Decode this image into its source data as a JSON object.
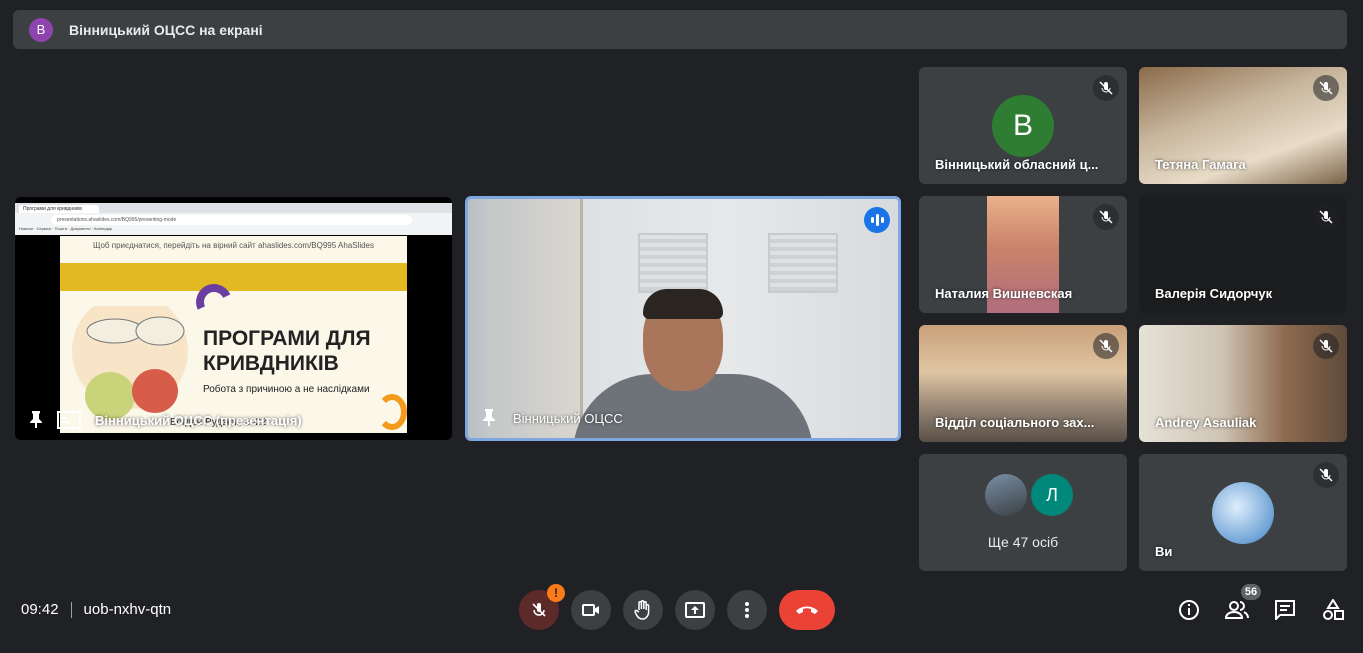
{
  "banner": {
    "avatar_letter": "В",
    "text": "Вінницький ОЦСС на екрані"
  },
  "presentation": {
    "name": "Вінницький ОЦСС (презентація)",
    "browser_tab": "Програми для кривдників",
    "address": "presentations.ahaslides.com/BQ995/presenting-mode",
    "bookmarks": "Новини · Сервіси · Пошта · Документи · Календар",
    "slide_header": "Щоб приєднатися, перейдіть на вірний сайт ahaslides.com/BQ995  AhaSlides",
    "slide_title_line1": "ПРОГРАМИ ДЛЯ",
    "slide_title_line2": "КРИВДНИКІВ",
    "slide_subtitle": "Робота з причиною а не наслідками",
    "slide_author": "Богдан Рудзюк, 2022"
  },
  "speaker": {
    "name": "Вінницький ОЦСС"
  },
  "participants": [
    {
      "name": "Вінницький обласний ц...",
      "avatar_letter": "В",
      "avatar_color": "#2e7d32"
    },
    {
      "name": "Тетяна Гамага"
    },
    {
      "name": "Наталия Вишневская"
    },
    {
      "name": "Валерія Сидорчук"
    },
    {
      "name": "Відділ соціального зах..."
    },
    {
      "name": "Andrey Asauliak"
    }
  ],
  "more": {
    "label": "Ще 47 осіб",
    "avatar_letter": "Л",
    "avatar_color": "#00897b"
  },
  "self": {
    "name": "Ви"
  },
  "bottom": {
    "time": "09:42",
    "meeting_code": "uob-nxhv-qtn",
    "warning_mark": "!",
    "participant_count": "56"
  },
  "colors": {
    "hangup": "#ea4335",
    "speaking": "#1a73e8",
    "warning": "#fa7b17"
  }
}
